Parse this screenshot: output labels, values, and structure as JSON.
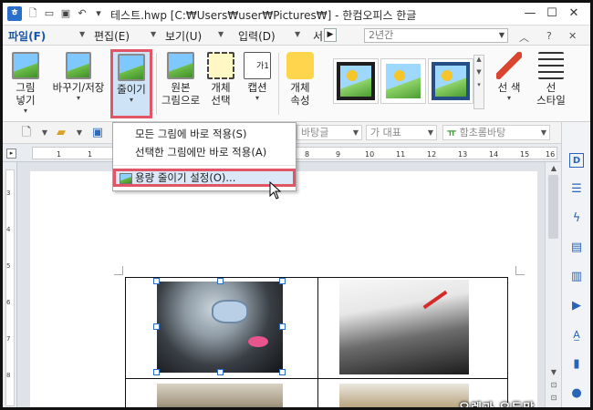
{
  "window": {
    "title": "테스트.hwp [C:₩Users₩user₩Pictures₩] - 한컴오피스 한글",
    "app_icon": "ㅎ",
    "min_label": "—",
    "max_label": "☐",
    "close_label": "✕"
  },
  "menubar": {
    "items": [
      {
        "label": "파일(F)"
      },
      {
        "label": "편집(E)"
      },
      {
        "label": "보기(U)"
      },
      {
        "label": "입력(D)"
      },
      {
        "label": "서"
      }
    ],
    "combo_value": "2년간",
    "help_label": "?",
    "close_label": "✕"
  },
  "ribbon": {
    "insert_picture": "그림\n넣기",
    "replace_save": "바꾸기/저장",
    "reduce": "줄이기",
    "original_picture": "원본\n그림으로",
    "select_object": "개체\n선택",
    "caption": "캡션",
    "caption_icon_text": "가1",
    "object_props": "개체\n속성",
    "line_color": "선 색",
    "line_style": "선\n스타일"
  },
  "toolbar2": {
    "style_combo": "바탕글",
    "font_face_combo": "대표",
    "font_name_combo": "함초롬바탕",
    "font_face_prefix": "가",
    "font_name_prefix": "ㅠ"
  },
  "ruler": {
    "numbers": [
      "1",
      "1",
      "2",
      "3",
      "4",
      "5",
      "6",
      "7",
      "8",
      "9",
      "10",
      "11",
      "12",
      "13",
      "14",
      "15",
      "16"
    ]
  },
  "vruler": {
    "numbers": [
      "3",
      "4",
      "5",
      "6",
      "7",
      "8"
    ]
  },
  "dropdown": {
    "items": [
      {
        "label": "모든 그림에 바로 적용(S)"
      },
      {
        "label": "선택한 그림에만 바로 적용(A)"
      },
      {
        "label": "용량 줄이기 설정(O)..."
      }
    ]
  },
  "document": {
    "watermark": "오렌과 오두막"
  },
  "icons": {
    "sidepanel": [
      "d-icon",
      "list-icon",
      "lightning-icon",
      "document-icon",
      "clipboard-icon",
      "play-icon",
      "spellcheck-icon",
      "bookmark-icon",
      "user-icon"
    ]
  }
}
